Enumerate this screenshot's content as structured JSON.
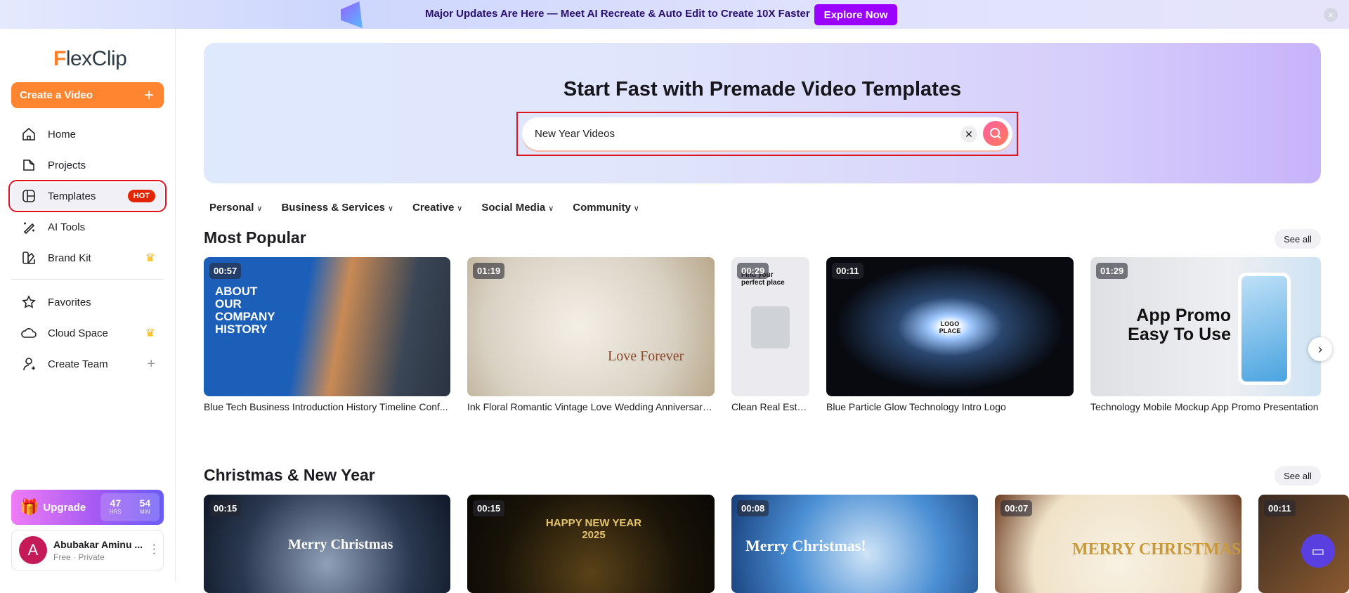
{
  "banner": {
    "text": "Major Updates Are Here — Meet AI Recreate & Auto Edit to Create 10X Faster",
    "button": "Explore Now",
    "close": "×"
  },
  "sidebar": {
    "logo_f": "F",
    "logo_rest": "lexClip",
    "create": "Create a Video",
    "create_plus": "+",
    "items": [
      {
        "label": "Home",
        "icon": "home-icon"
      },
      {
        "label": "Projects",
        "icon": "projects-icon"
      },
      {
        "label": "Templates",
        "icon": "templates-icon",
        "badge": "HOT"
      },
      {
        "label": "AI Tools",
        "icon": "magic-wand-icon"
      },
      {
        "label": "Brand Kit",
        "icon": "brand-kit-icon",
        "badge": "♛"
      },
      {
        "label": "Favorites",
        "icon": "star-icon"
      },
      {
        "label": "Cloud Space",
        "icon": "cloud-icon",
        "badge": "♛"
      },
      {
        "label": "Create Team",
        "icon": "add-user-icon",
        "badge": "+"
      }
    ],
    "upgrade": {
      "label": "Upgrade",
      "hrs": "47",
      "hrs_label": "HRS",
      "min": "54",
      "min_label": "MIN"
    },
    "user": {
      "initial": "A",
      "name": "Abubakar Aminu ...",
      "plan": "Free · Private"
    }
  },
  "hero": {
    "title": "Start Fast with Premade Video Templates",
    "search_value": "New Year Videos"
  },
  "categories": [
    "Personal",
    "Business & Services",
    "Creative",
    "Social Media",
    "Community"
  ],
  "sections": [
    {
      "title": "Most Popular",
      "see_all": "See all",
      "cards": [
        {
          "duration": "00:57",
          "title": "Blue Tech Business Introduction History Timeline Conf...",
          "thumb_text": "ABOUT OUR COMPANY HISTORY"
        },
        {
          "duration": "01:19",
          "title": "Ink Floral Romantic Vintage Love Wedding Anniversary ...",
          "thumb_text": "Love Forever"
        },
        {
          "duration": "00:29",
          "title": "Clean Real Estat...",
          "thumb_text": "Find your perfect place"
        },
        {
          "duration": "00:11",
          "title": "Blue Particle Glow Technology Intro Logo",
          "thumb_text": "LOGO PLACE"
        },
        {
          "duration": "01:29",
          "title": "Technology Mobile Mockup App Promo Presentation",
          "thumb_text": "App Promo Easy To Use"
        }
      ]
    },
    {
      "title": "Christmas & New Year",
      "see_all": "See all",
      "cards": [
        {
          "duration": "00:15",
          "thumb_text": "Merry Christmas"
        },
        {
          "duration": "00:15",
          "thumb_text": "HAPPY NEW YEAR 2025"
        },
        {
          "duration": "00:08",
          "thumb_text": "Merry Christmas!"
        },
        {
          "duration": "00:07",
          "thumb_text": "MERRY CHRISTMAS"
        },
        {
          "duration": "00:11"
        }
      ]
    }
  ]
}
